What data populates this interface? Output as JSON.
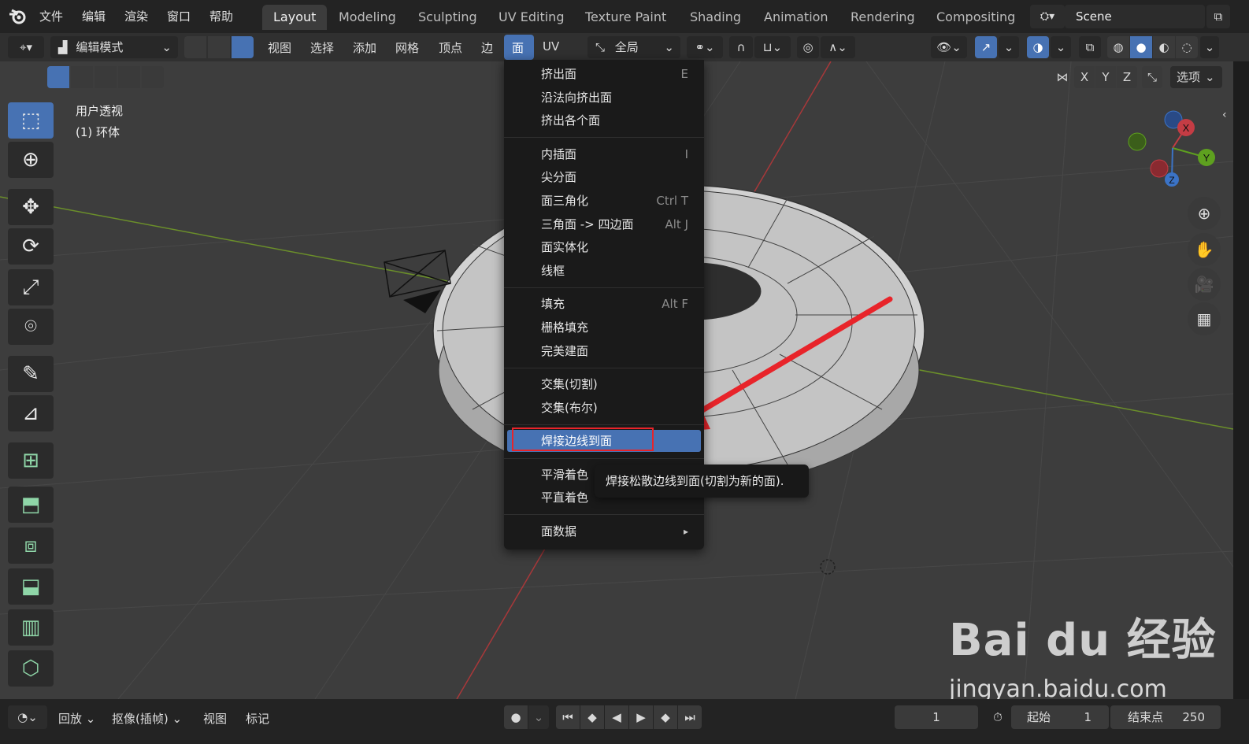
{
  "topbar": {
    "menus": [
      "文件",
      "编辑",
      "渲染",
      "窗口",
      "帮助"
    ],
    "workspace_tabs": [
      "Layout",
      "Modeling",
      "Sculpting",
      "UV Editing",
      "Texture Paint",
      "Shading",
      "Animation",
      "Rendering",
      "Compositing"
    ],
    "active_tab": "Layout",
    "scene": "Scene"
  },
  "header": {
    "mode": "编辑模式",
    "menus": [
      "视图",
      "选择",
      "添加",
      "网格",
      "顶点",
      "边",
      "面",
      "UV"
    ],
    "transform_orientation": "全局",
    "axes": [
      "X",
      "Y",
      "Z"
    ],
    "options": "选项"
  },
  "viewport": {
    "view_name": "用户透视",
    "object_name": "(1) 环体"
  },
  "face_menu": {
    "items": [
      {
        "label": "挤出面",
        "shortcut": "E"
      },
      {
        "label": "沿法向挤出面",
        "shortcut": ""
      },
      {
        "label": "挤出各个面",
        "shortcut": ""
      },
      {
        "label": "内插面",
        "shortcut": "I"
      },
      {
        "label": "尖分面",
        "shortcut": ""
      },
      {
        "label": "面三角化",
        "shortcut": "Ctrl T"
      },
      {
        "label": "三角面 -> 四边面",
        "shortcut": "Alt J"
      },
      {
        "label": "面实体化",
        "shortcut": ""
      },
      {
        "label": "线框",
        "shortcut": ""
      },
      {
        "label": "填充",
        "shortcut": "Alt F"
      },
      {
        "label": "栅格填充",
        "shortcut": ""
      },
      {
        "label": "完美建面",
        "shortcut": ""
      },
      {
        "label": "交集(切割)",
        "shortcut": ""
      },
      {
        "label": "交集(布尔)",
        "shortcut": ""
      },
      {
        "label": "焊接边线到面",
        "shortcut": ""
      },
      {
        "label": "平滑着色",
        "shortcut": ""
      },
      {
        "label": "平直着色",
        "shortcut": ""
      },
      {
        "label": "面数据",
        "shortcut": "▸"
      }
    ],
    "highlighted": "焊接边线到面",
    "tooltip": "焊接松散边线到面(切割为新的面)."
  },
  "gizmo": {
    "x": "X",
    "y": "Y",
    "z": "Z"
  },
  "timeline": {
    "playback": "回放",
    "keying": "抠像(插帧)",
    "view": "视图",
    "marker": "标记",
    "current_frame": "1",
    "start_label": "起始",
    "start": "1",
    "end_label": "结束点",
    "end": "250"
  },
  "watermark": {
    "brand": "Bai du 经验",
    "url": "jingyan.baidu.com"
  },
  "colors": {
    "accent": "#4772b3",
    "highlight_box": "#e8242a",
    "arrow": "#e8242a"
  }
}
